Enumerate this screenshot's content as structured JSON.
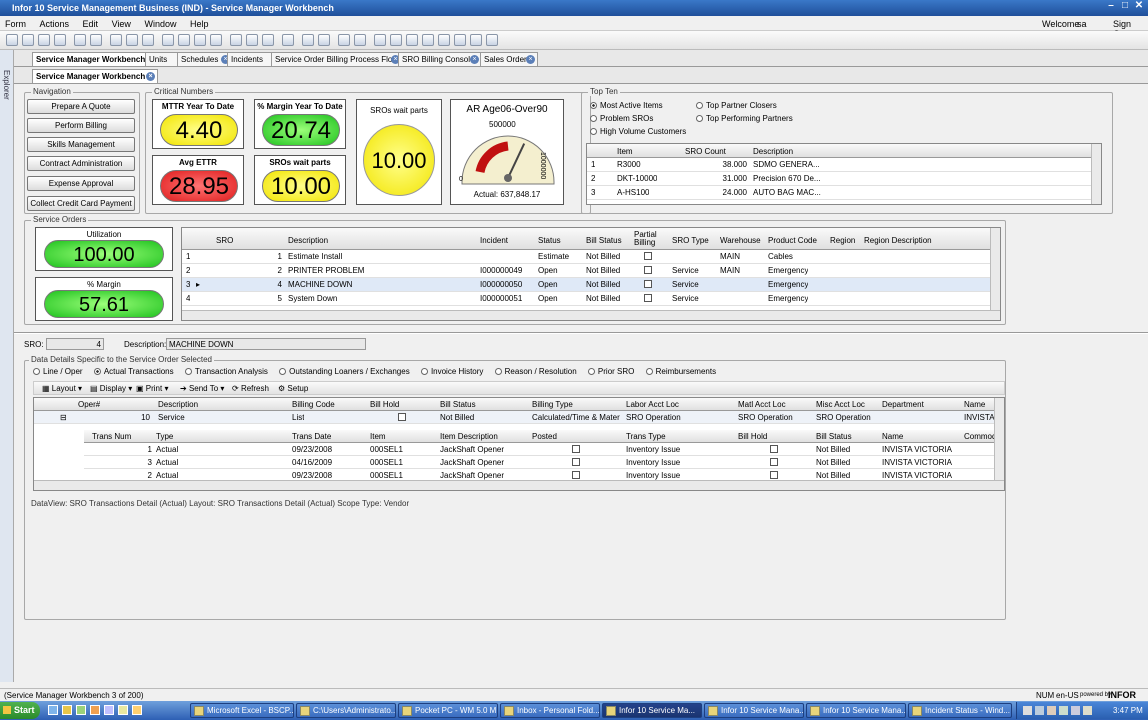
{
  "window": {
    "title": "Infor 10 Service Management Business (IND) - Service Manager Workbench"
  },
  "menu": [
    "Form",
    "Actions",
    "Edit",
    "View",
    "Window",
    "Help"
  ],
  "header_right": {
    "welcome": "Welcome",
    "user": "sa",
    "signout": "Sign Out"
  },
  "tabs": [
    "Service Manager Workbench",
    "Units",
    "Schedules",
    "Incidents",
    "Service Order Billing Process Flow",
    "SRO Billing Console",
    "Sales Orders"
  ],
  "subtab": "Service Manager Workbench",
  "left_strip": "Explorer",
  "navigation": {
    "title": "Navigation",
    "buttons": [
      "Prepare A Quote",
      "Perform Billing",
      "Skills Management",
      "Contract Administration",
      "Expense Approval",
      "Collect Credit Card Payment"
    ]
  },
  "critical": {
    "title": "Critical Numbers",
    "tiles": [
      {
        "label": "MTTR Year To Date",
        "value": "4.40",
        "color": "yellow"
      },
      {
        "label": "% Margin Year To Date",
        "value": "20.74",
        "color": "green"
      },
      {
        "label": "Avg ETTR",
        "value": "28.95",
        "color": "red"
      },
      {
        "label": "SROs wait parts",
        "value": "10.00",
        "color": "yellow"
      }
    ],
    "big_tile": {
      "label": "SROs wait parts",
      "value": "10.00"
    },
    "gauge": {
      "label": "AR Age06-Over90",
      "top": "500000",
      "left_tick": "0",
      "right_tick": "1000000",
      "actual": "Actual: 637,848.17",
      "fraction": 0.64
    }
  },
  "top_ten": {
    "title": "Top Ten",
    "options": [
      {
        "label": "Most Active Items",
        "selected": true
      },
      {
        "label": "Problem SROs",
        "selected": false
      },
      {
        "label": "High Volume Customers",
        "selected": false
      },
      {
        "label": "Top Partner Closers",
        "selected": false
      },
      {
        "label": "Top Performing Partners",
        "selected": false
      }
    ],
    "columns": [
      "Item",
      "SRO Count",
      "Description"
    ],
    "rows": [
      {
        "n": "1",
        "item": "R3000",
        "count": "38.000",
        "desc": "SDMO GENERA..."
      },
      {
        "n": "2",
        "item": "DKT-10000",
        "count": "31.000",
        "desc": "Precision 670 De..."
      },
      {
        "n": "3",
        "item": "A-HS100",
        "count": "24.000",
        "desc": "AUTO BAG MAC..."
      }
    ]
  },
  "service_orders": {
    "title": "Service Orders",
    "utilization": {
      "label": "Utilization",
      "value": "100.00"
    },
    "margin": {
      "label": "% Margin",
      "value": "57.61"
    },
    "columns": [
      "SRO",
      "Description",
      "Incident",
      "Status",
      "Bill Status",
      "Partial Billing",
      "SRO Type",
      "Warehouse",
      "Product Code",
      "Region",
      "Region Description"
    ],
    "rows": [
      {
        "n": "1",
        "sro": "1",
        "desc": "Estimate Install",
        "incident": "",
        "status": "Estimate",
        "bill": "Not Billed",
        "type": "",
        "wh": "MAIN",
        "prod": "Cables"
      },
      {
        "n": "2",
        "sro": "2",
        "desc": "PRINTER PROBLEM",
        "incident": "I000000049",
        "status": "Open",
        "bill": "Not Billed",
        "type": "Service",
        "wh": "MAIN",
        "prod": "Emergency"
      },
      {
        "n": "3",
        "sro": "4",
        "desc": "MACHINE DOWN",
        "incident": "I000000050",
        "status": "Open",
        "bill": "Not Billed",
        "type": "Service",
        "wh": "",
        "prod": "Emergency"
      },
      {
        "n": "4",
        "sro": "5",
        "desc": "System Down",
        "incident": "I000000051",
        "status": "Open",
        "bill": "Not Billed",
        "type": "Service",
        "wh": "",
        "prod": "Emergency"
      }
    ]
  },
  "detail": {
    "sro_label": "SRO:",
    "sro_value": "4",
    "desc_label": "Description:",
    "desc_value": "MACHINE DOWN",
    "group_title": "Data Details Specific to the Service Order Selected",
    "radios": [
      {
        "label": "Line / Oper",
        "selected": false
      },
      {
        "label": "Actual Transactions",
        "selected": true
      },
      {
        "label": "Transaction Analysis",
        "selected": false
      },
      {
        "label": "Outstanding Loaners / Exchanges",
        "selected": false
      },
      {
        "label": "Invoice History",
        "selected": false
      },
      {
        "label": "Reason / Resolution",
        "selected": false
      },
      {
        "label": "Prior SRO",
        "selected": false
      },
      {
        "label": "Reimbursements",
        "selected": false
      }
    ],
    "toolbar": [
      "Layout",
      "Display",
      "Print",
      "Send To",
      "Refresh",
      "Setup"
    ],
    "oper_columns": [
      "Oper#",
      "Description",
      "Billing Code",
      "Bill Hold",
      "Bill Status",
      "Billing Type",
      "Labor Acct Loc",
      "Matl Acct Loc",
      "Misc Acct Loc",
      "Department",
      "Name"
    ],
    "oper_row": {
      "oper": "10",
      "desc": "Service",
      "code": "List",
      "status": "Not Billed",
      "type": "Calculated/Time & Mater...",
      "labor": "SRO Operation",
      "matl": "SRO Operation",
      "misc": "SRO Operation",
      "name": "INVISTA"
    },
    "trans_columns": [
      "Trans Num",
      "Type",
      "Trans Date",
      "Item",
      "Item Description",
      "Posted",
      "Trans Type",
      "Bill Hold",
      "Bill Status",
      "Name",
      "Commod"
    ],
    "trans_rows": [
      {
        "num": "1",
        "type": "Actual",
        "date": "09/23/2008",
        "item": "000SEL1",
        "desc": "JackShaft Opener",
        "ttype": "Inventory Issue",
        "bill": "Not Billed",
        "name": "INVISTA VICTORIA"
      },
      {
        "num": "3",
        "type": "Actual",
        "date": "04/16/2009",
        "item": "000SEL1",
        "desc": "JackShaft Opener",
        "ttype": "Inventory Issue",
        "bill": "Not Billed",
        "name": "INVISTA VICTORIA"
      },
      {
        "num": "2",
        "type": "Actual",
        "date": "09/23/2008",
        "item": "000SEL1",
        "desc": "JackShaft Opener",
        "ttype": "Inventory Issue",
        "bill": "Not Billed",
        "name": "INVISTA VICTORIA"
      }
    ],
    "dataview": "DataView: SRO Transactions Detail (Actual)  Layout: SRO Transactions Detail (Actual)  Scope Type: Vendor"
  },
  "status": {
    "left": "(Service Manager Workbench 3 of 200)",
    "num": "NUM",
    "locale": "en-US",
    "powered": "powered by",
    "brand": "INFOR"
  },
  "taskbar": {
    "start": "Start",
    "tasks": [
      "Microsoft Excel - BSCP...",
      "C:\\Users\\Administrato...",
      "Pocket PC - WM 5.0 M...",
      "Inbox - Personal Fold...",
      "Infor 10 Service Ma...",
      "Infor 10 Service Mana...",
      "Infor 10 Service Mana...",
      "Incident Status - Wind..."
    ],
    "clock": "3:47 PM"
  }
}
